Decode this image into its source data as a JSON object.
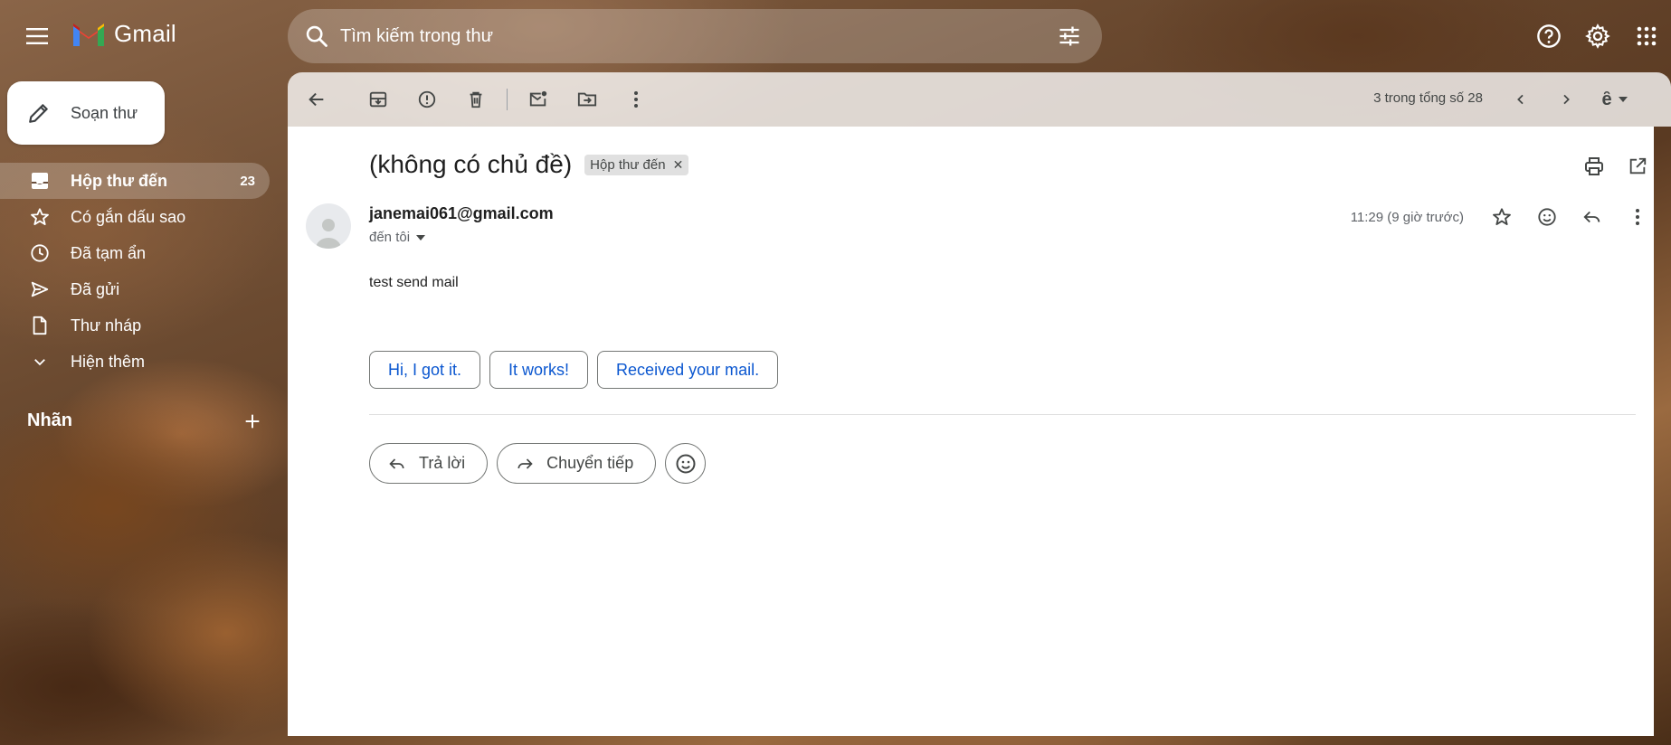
{
  "app": {
    "name": "Gmail"
  },
  "search": {
    "placeholder": "Tìm kiếm trong thư"
  },
  "sidebar": {
    "compose_label": "Soạn thư",
    "items": [
      {
        "label": "Hộp thư đến",
        "count": "23",
        "icon": "inbox-icon",
        "active": true
      },
      {
        "label": "Có gắn dấu sao",
        "icon": "star-icon"
      },
      {
        "label": "Đã tạm ẩn",
        "icon": "clock-icon"
      },
      {
        "label": "Đã gửi",
        "icon": "send-icon"
      },
      {
        "label": "Thư nháp",
        "icon": "draft-icon"
      },
      {
        "label": "Hiện thêm",
        "icon": "chevron-down-icon"
      }
    ],
    "labels_heading": "Nhãn"
  },
  "toolbar": {
    "pager": "3 trong tổng số 28"
  },
  "email": {
    "subject": "(không có chủ đề)",
    "label_chip": "Hộp thư đến",
    "sender": "janemai061@gmail.com",
    "to": "đến tôi",
    "time": "11:29 (9 giờ trước)",
    "body": "test send mail",
    "smart_replies": [
      "Hi, I got it.",
      "It works!",
      "Received your mail."
    ],
    "reply_label": "Trả lời",
    "forward_label": "Chuyển tiếp"
  },
  "colors": {
    "accent": "#0b57d0",
    "gmail_red": "#ea4335"
  }
}
